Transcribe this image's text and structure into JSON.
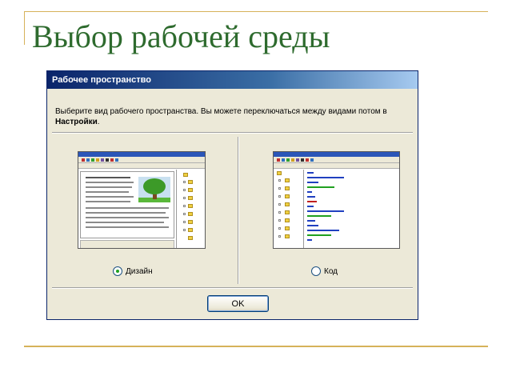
{
  "slide": {
    "title": "Выбор рабочей среды"
  },
  "dialog": {
    "title": "Рабочее пространство",
    "description_text": "Выберите вид рабочего пространства. Вы можете переключаться между видами потом в ",
    "description_bold": "Настройки",
    "description_end": ".",
    "options": [
      {
        "label": "Дизайн",
        "selected": true
      },
      {
        "label": "Код",
        "selected": false
      }
    ],
    "ok_label": "OK"
  },
  "colors": {
    "title_color": "#2e6b2e",
    "accent_line": "#d6b25a",
    "titlebar": "#0a246a",
    "dialog_bg": "#ece9d8",
    "radio_selected": "#21a121"
  }
}
